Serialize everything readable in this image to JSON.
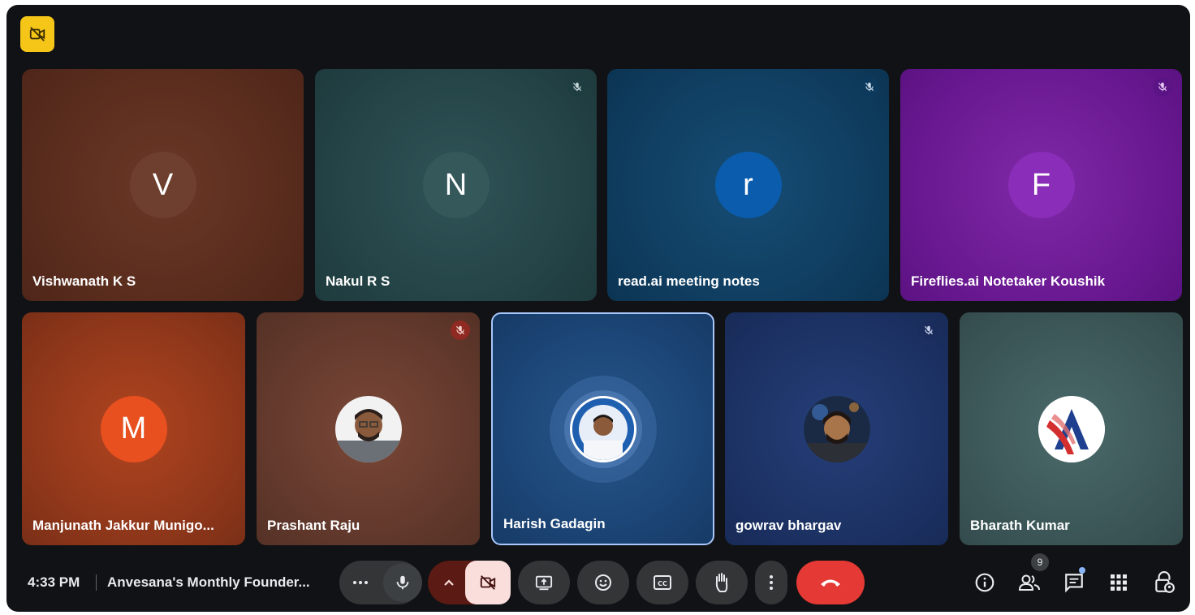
{
  "participants": [
    {
      "name": "Vishwanath K S",
      "initial": "V",
      "avatar_color": "#6e3f2e"
    },
    {
      "name": "Nakul R S",
      "initial": "N",
      "avatar_color": "#35585b"
    },
    {
      "name": "read.ai meeting notes",
      "initial": "r",
      "avatar_color": "#0b5cad"
    },
    {
      "name": "Fireflies.ai Notetaker Koushik",
      "initial": "F",
      "avatar_color": "#8a2db8"
    },
    {
      "name": "Manjunath Jakkur Munigo...",
      "initial": "M",
      "avatar_color": "#e8501f"
    },
    {
      "name": "Prashant Raju"
    },
    {
      "name": "Harish Gadagin"
    },
    {
      "name": "gowrav bhargav"
    },
    {
      "name": "Bharath Kumar"
    }
  ],
  "status_bar": {
    "time": "4:33 PM",
    "meeting_title": "Anvesana's Monthly Founder..."
  },
  "people_count": "9",
  "icons": {
    "badge": "camera-off-icon",
    "mute": "mic-off-icon",
    "more_options": "more-horiz-icon",
    "mic": "mic-icon",
    "chevron": "chevron-up-icon",
    "camera": "videocam-off-icon",
    "present": "present-to-all-icon",
    "reactions": "emoji-icon",
    "captions": "closed-captions-icon",
    "raise_hand": "hand-icon",
    "more_vert": "more-vert-icon",
    "leave": "call-end-icon",
    "info": "info-icon",
    "people": "people-icon",
    "chat": "chat-icon",
    "activities": "apps-grid-icon",
    "host_controls": "lock-person-icon"
  },
  "colors": {
    "leave_button": "#e53935",
    "camera_off_button": "#f9dedc",
    "badge": "#f5c518",
    "active_speaker_border": "#a8c7fa"
  }
}
